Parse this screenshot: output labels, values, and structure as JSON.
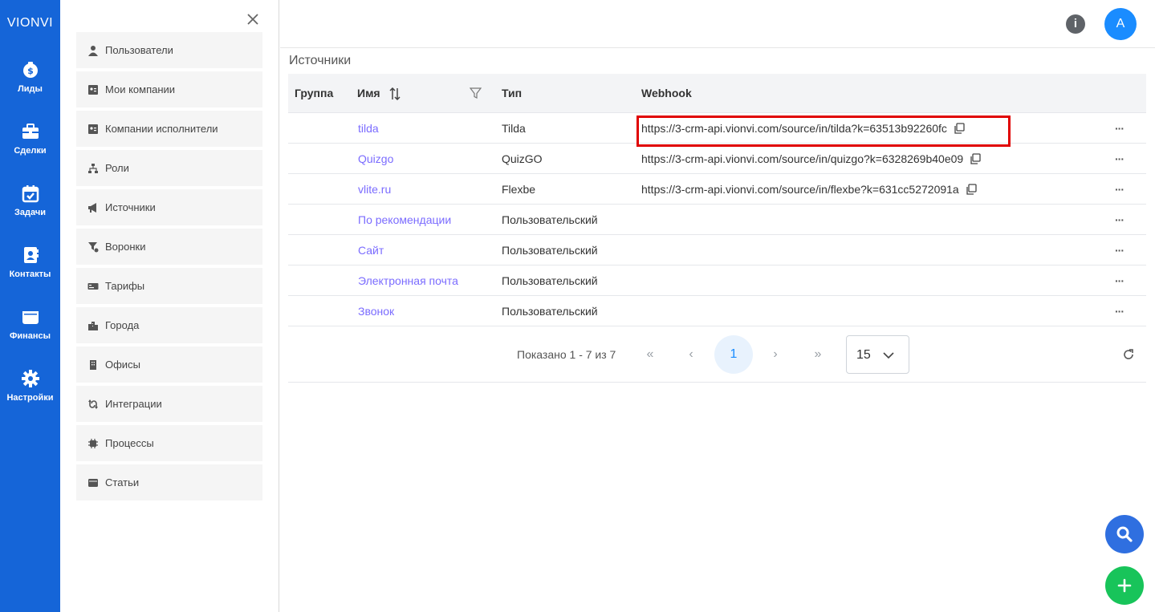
{
  "rail": {
    "brand": "VIONVI",
    "items": [
      {
        "label": "Лиды",
        "icon": "money-bag-icon"
      },
      {
        "label": "Сделки",
        "icon": "briefcase-icon"
      },
      {
        "label": "Задачи",
        "icon": "calendar-check-icon"
      },
      {
        "label": "Контакты",
        "icon": "contact-book-icon"
      },
      {
        "label": "Финансы",
        "icon": "wallet-icon"
      },
      {
        "label": "Настройки",
        "icon": "gear-icon"
      }
    ]
  },
  "menu": {
    "items": [
      {
        "label": "Пользователи",
        "icon": "user-icon"
      },
      {
        "label": "Мои компании",
        "icon": "address-card-icon"
      },
      {
        "label": "Компании исполнители",
        "icon": "address-card-icon"
      },
      {
        "label": "Роли",
        "icon": "hierarchy-icon"
      },
      {
        "label": "Источники",
        "icon": "megaphone-icon"
      },
      {
        "label": "Воронки",
        "icon": "funnel-gear-icon"
      },
      {
        "label": "Тарифы",
        "icon": "money-bill-icon"
      },
      {
        "label": "Города",
        "icon": "city-icon"
      },
      {
        "label": "Офисы",
        "icon": "building-icon"
      },
      {
        "label": "Интеграции",
        "icon": "sync-icon"
      },
      {
        "label": "Процессы",
        "icon": "chip-icon"
      },
      {
        "label": "Статьи",
        "icon": "wallet-icon"
      }
    ]
  },
  "header": {
    "help": "i",
    "avatar": "A"
  },
  "page": {
    "title": "Источники"
  },
  "table": {
    "columns": {
      "group": "Группа",
      "name": "Имя",
      "type": "Тип",
      "webhook": "Webhook"
    },
    "rows": [
      {
        "group": "",
        "name": "tilda",
        "type": "Tilda",
        "webhook": "https://3-crm-api.vionvi.com/source/in/tilda?k=63513b92260fc"
      },
      {
        "group": "",
        "name": "Quizgo",
        "type": "QuizGO",
        "webhook": "https://3-crm-api.vionvi.com/source/in/quizgo?k=6328269b40e09"
      },
      {
        "group": "",
        "name": "vlite.ru",
        "type": "Flexbe",
        "webhook": "https://3-crm-api.vionvi.com/source/in/flexbe?k=631cc5272091a"
      },
      {
        "group": "",
        "name": "По рекомендации",
        "type": "Пользовательский",
        "webhook": ""
      },
      {
        "group": "",
        "name": "Сайт",
        "type": "Пользовательский",
        "webhook": ""
      },
      {
        "group": "",
        "name": "Электронная почта",
        "type": "Пользовательский",
        "webhook": ""
      },
      {
        "group": "",
        "name": "Звонок",
        "type": "Пользовательский",
        "webhook": ""
      }
    ],
    "row_actions": "···"
  },
  "pagination": {
    "info": "Показано 1 - 7 из 7",
    "first": "«",
    "prev": "‹",
    "current": "1",
    "next": "›",
    "last": "»",
    "page_size": "15"
  },
  "colors": {
    "rail": "#1565d8",
    "link": "#7b6cff",
    "highlight": "#e00000",
    "fab_search": "#2f6fe0",
    "fab_add": "#18c45a"
  }
}
